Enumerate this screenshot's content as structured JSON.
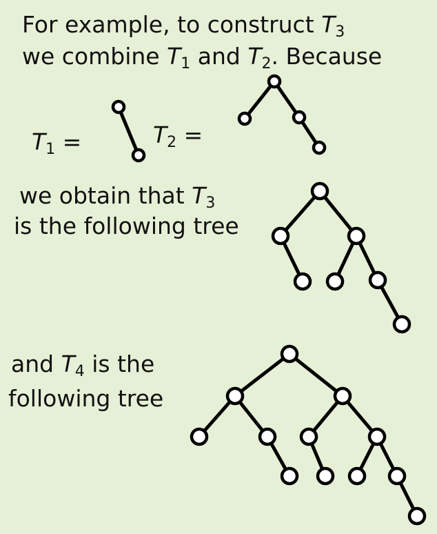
{
  "intro": {
    "line1_prefix": "For example, to construct ",
    "t3_letter": "T",
    "t3_sub": "3",
    "line2_prefix": "we combine ",
    "t1_letter": "T",
    "t1_sub": "1",
    "and": " and ",
    "t2_letter": "T",
    "t2_sub": "2",
    "line2_suffix": ". Because"
  },
  "equations": {
    "t1_letter": "T",
    "t1_sub": "1",
    "eq1": " =",
    "t2_letter": "T",
    "t2_sub": "2",
    "eq2": " ="
  },
  "t3_text": {
    "line1_prefix": "we obtain that ",
    "t3_letter": "T",
    "t3_sub": "3",
    "line2": "is the following tree"
  },
  "t4_text": {
    "line1_prefix": "and ",
    "t4_letter": "T",
    "t4_sub": "4",
    "line1_suffix": " is the",
    "line2": "following tree"
  }
}
